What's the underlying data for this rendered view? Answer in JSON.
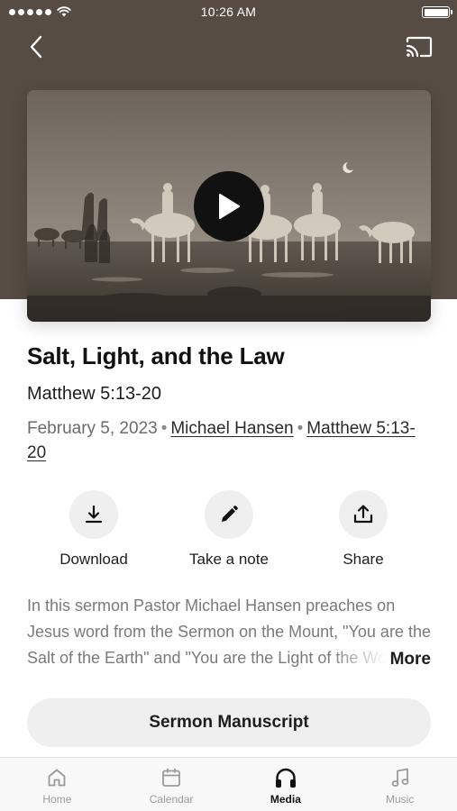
{
  "status_bar": {
    "time": "10:26 AM"
  },
  "header": {
    "back_icon": "chevron-left-icon",
    "cast_icon": "cast-icon"
  },
  "media": {
    "artwork_description": "sepia engraving of a caravan of camels with riders crossing a desert under a crescent moon",
    "play_icon": "play-icon"
  },
  "sermon": {
    "title": "Salt, Light, and the Law",
    "scripture": "Matthew 5:13-20",
    "date": "February 5, 2023",
    "separator": "•",
    "speaker": "Michael Hansen",
    "passage_link": "Matthew 5:13-20"
  },
  "actions": [
    {
      "label": "Download",
      "icon": "download-icon"
    },
    {
      "label": "Take a note",
      "icon": "pencil-icon"
    },
    {
      "label": "Share",
      "icon": "share-icon"
    }
  ],
  "description": {
    "text": "In this sermon Pastor Michael Hansen preaches on Jesus word from the Sermon on the Mount, \"You are the Salt of the Earth\" and \"You are the Light of the World\"",
    "more_label": "More"
  },
  "manuscript_button": {
    "label": "Sermon Manuscript"
  },
  "tab_bar": {
    "active": "Media",
    "tabs": [
      {
        "label": "Home",
        "icon": "home-icon"
      },
      {
        "label": "Calendar",
        "icon": "calendar-icon"
      },
      {
        "label": "Media",
        "icon": "headphones-icon"
      },
      {
        "label": "Music",
        "icon": "music-note-icon"
      }
    ]
  },
  "colors": {
    "hero_background": "#564c43",
    "button_background": "#efefef",
    "tab_active": "#111111",
    "tab_inactive": "#9a9a9a"
  }
}
